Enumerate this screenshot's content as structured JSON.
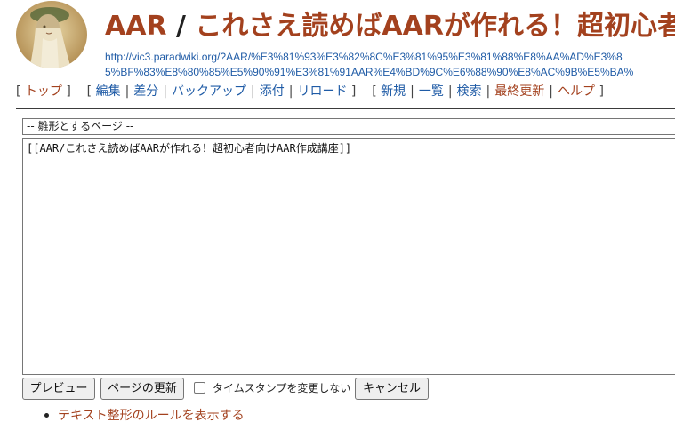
{
  "header": {
    "title_prefix": "AAR",
    "title_separator": "/",
    "title_page": "これさえ読めばAARが作れる！超初心者",
    "url_line1": "http://vic3.paradwiki.org/?AAR/%E3%81%93%E3%82%8C%E3%81%95%E3%81%88%E8%AA%AD%E3%8",
    "url_line2": "5%BF%83%E8%80%85%E5%90%91%E3%81%91AAR%E4%BD%9C%E6%88%90%E8%AC%9B%E5%BA%"
  },
  "nav": {
    "groups": [
      {
        "items": [
          "トップ"
        ]
      },
      {
        "items": [
          "編集",
          "差分",
          "バックアップ",
          "添付",
          "リロード"
        ]
      },
      {
        "items": [
          "新規",
          "一覧",
          "検索",
          "最終更新",
          "ヘルプ"
        ]
      }
    ]
  },
  "editor": {
    "template_select_value": "-- 雛形とするページ --",
    "content": "[[AAR/これさえ読めばAARが作れる！超初心者向けAAR作成講座]]"
  },
  "buttons": {
    "preview": "プレビュー",
    "update": "ページの更新",
    "timestamp_label": "タイムスタンプを変更しない",
    "timestamp_checked": false,
    "cancel": "キャンセル"
  },
  "footer": {
    "rules_link": "テキスト整形のルールを表示する"
  },
  "colors": {
    "link": "#1f5ba6",
    "visited_link": "#a3411e",
    "rule": "#3a3a3a"
  },
  "icons": {
    "logo": "portrait-logo"
  }
}
